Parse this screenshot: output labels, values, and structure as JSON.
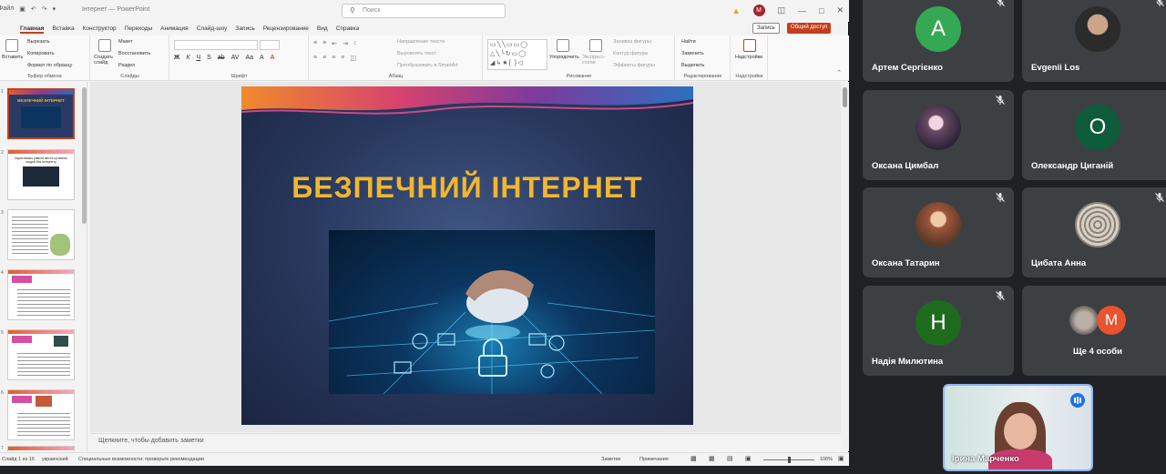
{
  "app": {
    "title_text": "Інтернет — PowerPoint",
    "menu_partial": "Файл",
    "search_placeholder": "Поиск",
    "account_initial": "М"
  },
  "menu": {
    "tabs": [
      "Главная",
      "Вставка",
      "Конструктор",
      "Переходы",
      "Анимация",
      "Слайд-шоу",
      "Запись",
      "Рецензирование",
      "Вид",
      "Справка"
    ],
    "record": "Запись",
    "share": "Общий доступ"
  },
  "ribbon": {
    "clipboard": {
      "paste": "Вставить",
      "cut": "Вырезать",
      "copy": "Копировать",
      "format": "Формат по образцу",
      "label": "Буфер обмена"
    },
    "slides": {
      "new": "Создать слайд",
      "layout": "Макет",
      "reset": "Восстановить",
      "section": "Раздел",
      "label": "Слайды"
    },
    "font": {
      "label": "Шрифт",
      "buttons": [
        "Ж",
        "К",
        "Ч",
        "S",
        "ab",
        "AV",
        "Aa",
        "A",
        "A"
      ]
    },
    "paragraph": {
      "label": "Абзац",
      "dir": "Направление текста",
      "align": "Выровнять текст",
      "smartart": "Преобразовать в SmartArt"
    },
    "drawing": {
      "arrange": "Упорядочить",
      "styles": "Экспресс-стили",
      "fill": "Заливка фигуры",
      "outline": "Контур фигуры",
      "effects": "Эффекты фигуры",
      "label": "Рисование"
    },
    "editing": {
      "find": "Найти",
      "replace": "Заменить",
      "select": "Выделить",
      "label": "Редактирование"
    },
    "addins": {
      "btn": "Надстройки",
      "label": "Надстройки"
    }
  },
  "slide": {
    "title": "БЕЗПЕЧНИЙ ІНТЕРНЕТ",
    "thumb1_title": "БЕЗПЕЧНИЙ ІНТЕРНЕТ",
    "thumb2_title": "Зараз важко уявити життя сучасних людей без Інтернету"
  },
  "thumb_numbers": [
    "1",
    "2",
    "3",
    "4",
    "5",
    "6",
    "7"
  ],
  "notes_placeholder": "Щелкните, чтобы добавить заметки",
  "status": {
    "slide": "Слайд 1 из 16",
    "lang": "украинский",
    "access": "Специальные возможности: проверьте рекомендации",
    "notes": "Заметки",
    "comments": "Примечания",
    "zoom": "106%"
  },
  "participants": [
    {
      "name": "Артем Сергієнко",
      "initial": "A",
      "color": "#34a853"
    },
    {
      "name": "Evgenii Los",
      "initial": "",
      "color": "#5f6368"
    },
    {
      "name": "Оксана Цимбал",
      "initial": "",
      "color": "#7b5a7f"
    },
    {
      "name": "Олександр Циганій",
      "initial": "O",
      "color": "#0d5c3c"
    },
    {
      "name": "Оксана Татарин",
      "initial": "",
      "color": "#a0563a"
    },
    {
      "name": "Цибата Анна",
      "initial": "",
      "color": "#8a8279"
    },
    {
      "name": "Надія Милютина",
      "initial": "H",
      "color": "#1e6b1e"
    }
  ],
  "more": {
    "label": "Ще 4 особи",
    "initial": "M",
    "color": "#e8542f"
  },
  "self_name": "Ірина Марченко"
}
